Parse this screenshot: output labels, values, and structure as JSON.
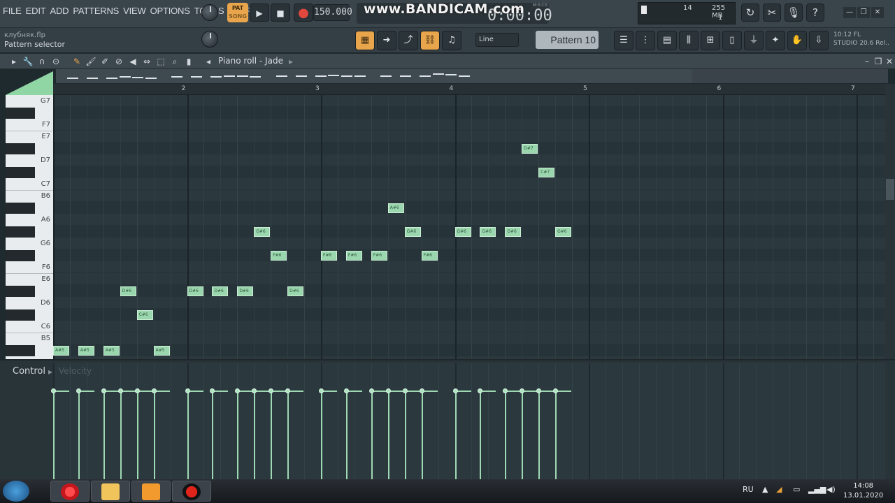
{
  "menu": [
    "FILE",
    "EDIT",
    "ADD",
    "PATTERNS",
    "VIEW",
    "OPTIONS",
    "TOOLS",
    "HELP"
  ],
  "project": {
    "filename": "клубняк.flp",
    "hint": "Pattern selector"
  },
  "transport": {
    "pat_label": "PAT",
    "song_label": "SONG",
    "tempo": "150.000",
    "time": "0:00:00",
    "time_format": "M:S:CS"
  },
  "watermark": "www.BANDICAM.com",
  "monitor": {
    "cpu": "14",
    "memory": "255 MB",
    "polyphony": "1"
  },
  "snap": "Line",
  "pattern": "Pattern 10",
  "version": {
    "line1": "10:12  FL",
    "line2": "STUDIO 20.6 Rel.."
  },
  "piano_roll": {
    "title": "Piano roll - Jade",
    "bars": [
      "2",
      "3",
      "4",
      "5",
      "6",
      "7"
    ],
    "key_labels": [
      "G7",
      "F7",
      "E7",
      "D7",
      "C7",
      "B6",
      "A6",
      "G6",
      "F6",
      "E6",
      "D6",
      "C6",
      "B5"
    ],
    "notes": [
      {
        "label": "A#5",
        "col": 0,
        "pitch": "A#5"
      },
      {
        "label": "A#5",
        "col": 1.5,
        "pitch": "A#5"
      },
      {
        "label": "A#5",
        "col": 3,
        "pitch": "A#5"
      },
      {
        "label": "D#6",
        "col": 4,
        "pitch": "D#6"
      },
      {
        "label": "C#6",
        "col": 5,
        "pitch": "C#6"
      },
      {
        "label": "A#5",
        "col": 6,
        "pitch": "A#5"
      },
      {
        "label": "D#6",
        "col": 8,
        "pitch": "D#6"
      },
      {
        "label": "D#6",
        "col": 9.5,
        "pitch": "D#6"
      },
      {
        "label": "D#6",
        "col": 11,
        "pitch": "D#6"
      },
      {
        "label": "G#6",
        "col": 12,
        "pitch": "G#6"
      },
      {
        "label": "F#6",
        "col": 13,
        "pitch": "F#6"
      },
      {
        "label": "D#6",
        "col": 14,
        "pitch": "D#6"
      },
      {
        "label": "F#6",
        "col": 16,
        "pitch": "F#6"
      },
      {
        "label": "F#6",
        "col": 17.5,
        "pitch": "F#6"
      },
      {
        "label": "F#6",
        "col": 19,
        "pitch": "F#6"
      },
      {
        "label": "A#6",
        "col": 20,
        "pitch": "A#6"
      },
      {
        "label": "G#6",
        "col": 21,
        "pitch": "G#6"
      },
      {
        "label": "F#6",
        "col": 22,
        "pitch": "F#6"
      },
      {
        "label": "G#6",
        "col": 24,
        "pitch": "G#6"
      },
      {
        "label": "G#6",
        "col": 25.5,
        "pitch": "G#6"
      },
      {
        "label": "G#6",
        "col": 27,
        "pitch": "G#6"
      },
      {
        "label": "D#7",
        "col": 28,
        "pitch": "D#7"
      },
      {
        "label": "C#7",
        "col": 29,
        "pitch": "C#7"
      },
      {
        "label": "G#6",
        "col": 30,
        "pitch": "G#6"
      }
    ]
  },
  "control": {
    "label": "Control",
    "param": "Velocity"
  },
  "taskbar": {
    "lang": "RU",
    "time": "14:08",
    "date": "13.01.2020"
  },
  "colors": {
    "note": "#9bd7ae",
    "accent": "#e8a54b",
    "grid": "#2b393e"
  }
}
